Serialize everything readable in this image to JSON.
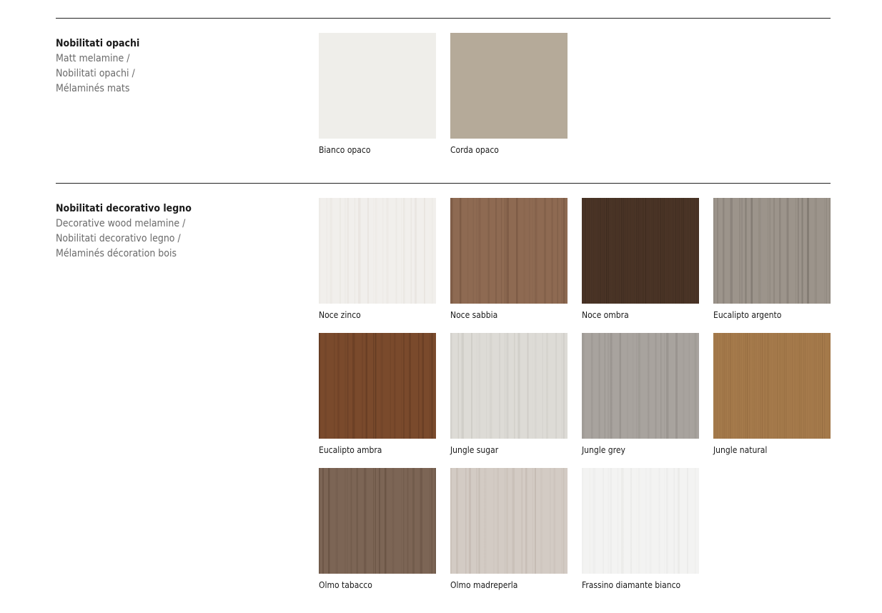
{
  "sections": [
    {
      "title": "Nobilitati opachi",
      "subtitles": [
        "Matt melamine /",
        "Nobilitati opachi /",
        "Mélaminés mats"
      ],
      "swatches": [
        {
          "label": "Bianco opaco",
          "color": "#efeeea",
          "grain": "none"
        },
        {
          "label": "Corda opaco",
          "color": "#b5aa99",
          "grain": "none"
        }
      ]
    },
    {
      "title": "Nobilitati decorativo legno",
      "subtitles": [
        "Decorative wood melamine /",
        "Nobilitati decorativo legno /",
        "Mélaminés décoration bois"
      ],
      "swatches": [
        {
          "label": "Noce zinco",
          "color": "#f1efec",
          "grain": "#e2ddd6"
        },
        {
          "label": "Noce sabbia",
          "color": "#8e6a52",
          "grain": "#6f4f3b"
        },
        {
          "label": "Noce ombra",
          "color": "#4a3426",
          "grain": "#2f2017"
        },
        {
          "label": "Eucalipto argento",
          "color": "#9c948b",
          "grain": "#6e675f"
        },
        {
          "label": "Eucalipto ambra",
          "color": "#7a4a2c",
          "grain": "#55311c"
        },
        {
          "label": "Jungle sugar",
          "color": "#dddbd6",
          "grain": "#c4c1bb"
        },
        {
          "label": "Jungle grey",
          "color": "#a8a39e",
          "grain": "#8c8782"
        },
        {
          "label": "Jungle natural",
          "color": "#a57a4b",
          "grain": "#835c34"
        },
        {
          "label": "Olmo tabacco",
          "color": "#7c6555",
          "grain": "#5c4738"
        },
        {
          "label": "Olmo madreperla",
          "color": "#d3cbc4",
          "grain": "#b9aea5"
        },
        {
          "label": "Frassino diamante bianco",
          "color": "#f3f3f2",
          "grain": "#e4e4e2"
        }
      ]
    }
  ]
}
